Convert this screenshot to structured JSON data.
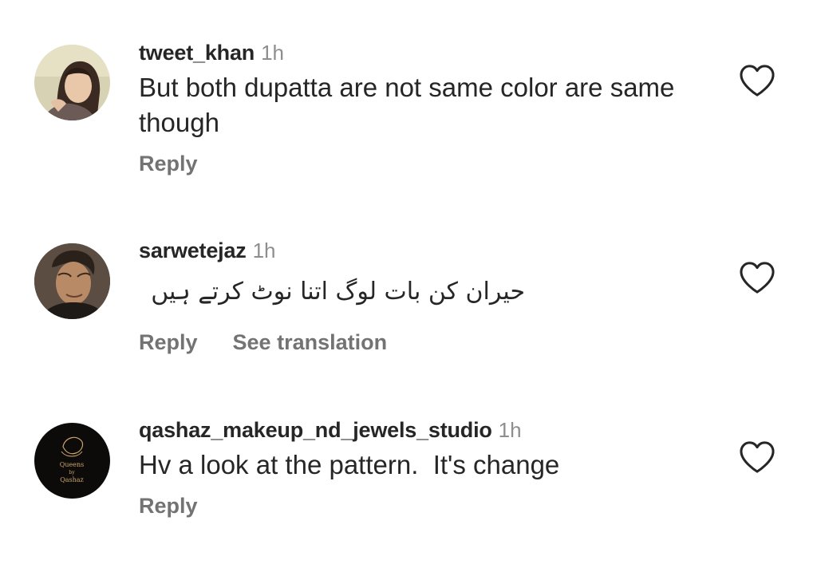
{
  "comments": [
    {
      "username": "tweet_khan",
      "time": "1h",
      "text": "But both dupatta are not same color are same though",
      "actions": [
        "Reply"
      ]
    },
    {
      "username": "sarwetejaz",
      "time": "1h",
      "text": "حیران کن بات لوگ اتنا نوٹ کرتے ہیں",
      "actions": [
        "Reply",
        "See translation"
      ]
    },
    {
      "username": "qashaz_makeup_nd_jewels_studio",
      "time": "1h",
      "text": "Hv a look at the pattern.  It's change",
      "actions": [
        "Reply"
      ],
      "avatar_logo_text": [
        "Queens",
        "by",
        "Qashaz"
      ]
    }
  ],
  "icons": {
    "like": "heart-outline-icon"
  },
  "colors": {
    "text": "#262626",
    "secondary": "#8e8e8e",
    "action": "#737373",
    "background": "#ffffff"
  }
}
